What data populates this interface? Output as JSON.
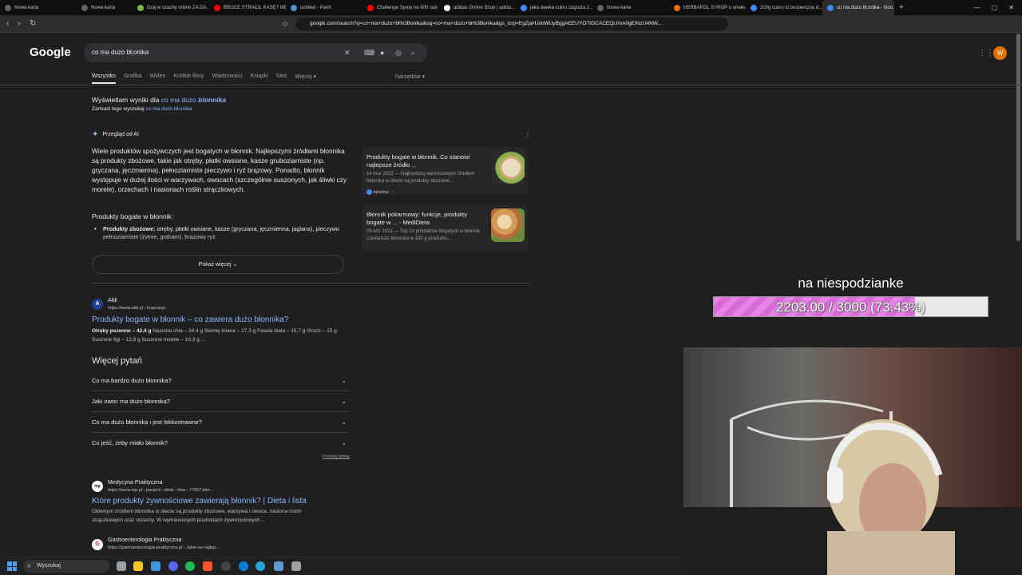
{
  "browser": {
    "tabs": [
      {
        "title": "Nowa karta",
        "color": "#5f6368"
      },
      {
        "title": "Nowa karta",
        "color": "#5f6368"
      },
      {
        "title": "Graj w szachy online ZA DA...",
        "color": "#81b64c"
      },
      {
        "title": "BRUCE STRACIŁ KASĘ? MEF...",
        "color": "#ff0000"
      },
      {
        "title": "untitled - Paint",
        "color": "#4a90d9"
      },
      {
        "title": "Challenge Syrop na 600 sub",
        "color": "#ff0000"
      },
      {
        "title": "adidas Online Shop | adida...",
        "color": "#ffffff"
      },
      {
        "title": "jaka dawka cukru zagraża ż...",
        "color": "#4285f4"
      },
      {
        "title": "Nowa karta",
        "color": "#5f6368"
      },
      {
        "title": "HERBAPOL SYROP o smaku ...",
        "color": "#e8710a"
      },
      {
        "title": "200g cukru to bezpieczna d...",
        "color": "#4285f4"
      },
      {
        "title": "co ma duzo bł;onika - Goo...",
        "color": "#4285f4"
      }
    ],
    "active_tab": 11,
    "url": "google.com/search?q=co+ma+duzo+bł%3Bonika&oq=co+ma+duzo+bł%3Bonika&gs_lcrp=EgZjaHJvbWUyBggAEEUYOTIGCACEQLhhA0gEINzU4NW..."
  },
  "google": {
    "logo": "Google",
    "query": "co ma duzo bł;onika",
    "avatar_letter": "W",
    "tabs": [
      "Wszystko",
      "Grafika",
      "Wideo",
      "Krótkie filmy",
      "Wiadomości",
      "Książki",
      "Sieć",
      "Więcej ▾"
    ],
    "tools": "Narzędzia ▾",
    "correction_prefix": "Wyświetlam wyniki dla",
    "correction_plain": "co ma duzo",
    "correction_bold": "blonnika",
    "instead_prefix": "Zamiast tego wyszukaj",
    "instead_link": "co ma duzo bł;onika",
    "ai_header": "Przegląd od AI",
    "ai_text": "Wiele produktów spożywczych jest bogatych w błonnik. Najlepszymi źródłami błonnika są produkty zbożowe, takie jak otręby, płatki owsiane, kasze gruboziarniste (np. gryczana, jęczmienna), pełnoziarniste pieczywo i ryż brązowy. Ponadto, błonnik występuje w dużej ilości w warzywach, owocach (szczególnie suszonych, jak śliwki czy morele), orzechach i nasionach roślin strączkowych.",
    "ai_subheading": "Produkty bogate w błonnik:",
    "ai_bullet_label": "Produkty zbożowe:",
    "ai_bullet_text": "otręby, płatki owsiane, kasze (gryczana, jęczmienna, jaglana), pieczywo pełnoziarniste (żytnie, graham), brązowy ryż.",
    "show_more": "Pokaż więcej",
    "cards": [
      {
        "title": "Produkty bogate w błonnik. Co stanowi najlepsze źródło ...",
        "desc": "14 mar 2022 — Najbardziej wartościowym źródłem błonnika w diecie są produkty zbożowe...",
        "source": "Apteline"
      },
      {
        "title": "Błonnik pokarmowy: funkcje, produkty bogate w ... - MediDieta",
        "desc": "25 wrz 2022 — Top 10 produktów bogatych w błonnik (zawartość błonnika w 100 g produktu..."
      }
    ],
    "results": [
      {
        "site": "Aldi",
        "url": "https://www.aldi.pl › Inspiracje",
        "title": "Produkty bogate w błonnik – co zawiera dużo błonnika?",
        "snippet_bold": "Otręby pszenne – 42,4 g",
        "snippet": "Nasiona chia – 34,4 g   Siemię lniane – 27,3 g   Fasola biała – 15,7 g   Groch – 15 g   Suszone figi – 12,9 g   Suszone morele – 10,3 g ...",
        "icon": "A"
      },
      {
        "site": "Medycyna Praktyczna",
        "url": "https://www.mp.pl › pacjent › dieta › lista › 77837,ktor...",
        "title": "Które produkty żywnościowe zawierają błonnik? | Dieta i lista",
        "snippet": "Głównym źródłem błonnika w diecie są produkty zbożowe, warzywa i owoce, nasiona roślin strączkowych oraz orzechy. W wymienionych produktach żywnościowych ...",
        "icon": "mp"
      },
      {
        "site": "Gastroenterologia Praktyczna",
        "url": "https://gastroenterologia-praktyczna.pl › Jakie-sa-najlep...",
        "icon": "G"
      }
    ],
    "paa_title": "Więcej pytań",
    "questions": [
      "Co ma bardzo dużo błonnika?",
      "Jaki owoc ma dużo błonnika?",
      "Co ma dużo błonnika i jest lekkostrawne?",
      "Co jeść, żeby miało błonnik?"
    ],
    "feedback": "Prześlij opinię"
  },
  "overlay": {
    "title": "na niespodzianke",
    "progress_text": "2203.00 / 3000 (73.43%)",
    "progress_fraction": 0.7343
  },
  "taskbar": {
    "search_placeholder": "Wyszukaj"
  }
}
